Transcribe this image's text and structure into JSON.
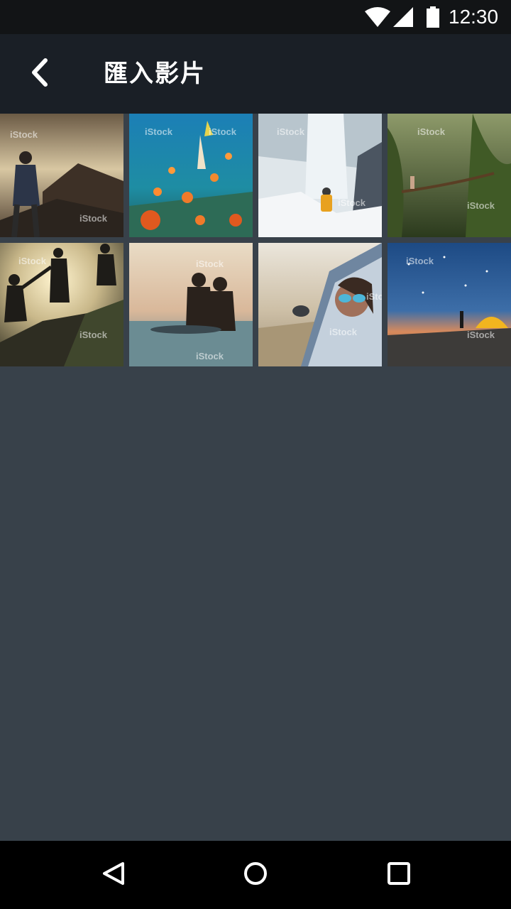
{
  "status_bar": {
    "time": "12:30",
    "icons": [
      "wifi-icon",
      "cell-signal-icon",
      "battery-icon"
    ]
  },
  "header": {
    "back_icon": "chevron-left-icon",
    "title": "匯入影片"
  },
  "videos": [
    {
      "name": "hiker-mountain-sunset",
      "watermark": "iStock"
    },
    {
      "name": "snorkeler-coral-reef",
      "watermark": "iStock"
    },
    {
      "name": "frozen-waterfall-hiker",
      "watermark": "iStock"
    },
    {
      "name": "rope-bridge-jungle",
      "watermark": "iStock"
    },
    {
      "name": "friends-helping-climb",
      "watermark": "iStock"
    },
    {
      "name": "surfers-sunset",
      "watermark": "iStock"
    },
    {
      "name": "woman-car-window",
      "watermark": "iStock"
    },
    {
      "name": "tent-under-milky-way",
      "watermark": "iStock"
    }
  ],
  "nav_bar": {
    "buttons": [
      "back-triangle-icon",
      "home-circle-icon",
      "recents-square-icon"
    ]
  },
  "colors": {
    "status_bar": "#121416",
    "app_bar": "#1a1f26",
    "background": "#38414a",
    "nav_bar": "#000000",
    "text": "#ffffff"
  }
}
